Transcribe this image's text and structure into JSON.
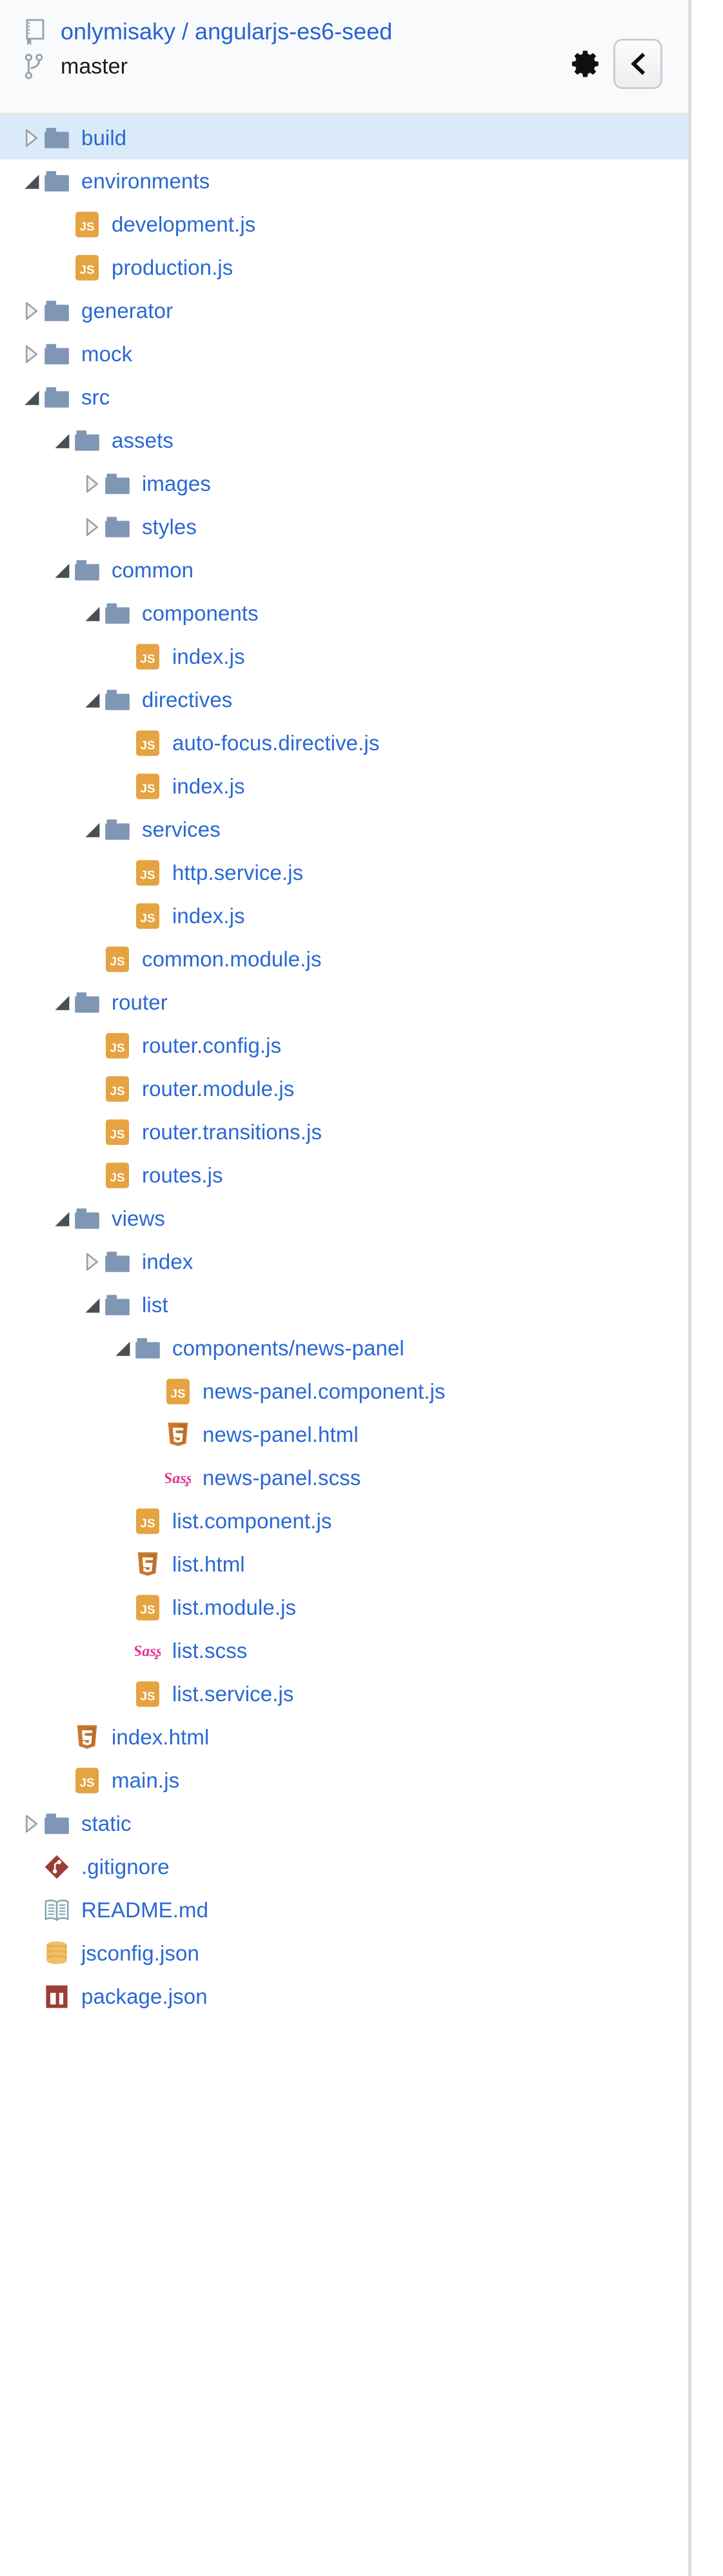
{
  "header": {
    "repo_icon": "repo-book-icon",
    "owner": "onlymisaky",
    "separator": "/",
    "repo_name": "angularjs-es6-seed",
    "repo_full": "onlymisaky / angularjs-es6-seed",
    "branch_icon": "git-branch-icon",
    "branch": "master",
    "settings_icon": "gear-icon",
    "collapse_icon": "chevron-left-icon",
    "settings_label": "Settings",
    "collapse_label": "Collapse panel",
    "colors": {
      "link": "#2962d0",
      "header_bg": "#f9fafb",
      "selected_row_bg": "#daeaf8"
    }
  },
  "tree": {
    "items": [
      {
        "label": "build",
        "depth": 0,
        "type": "folder",
        "icon": "folder-icon",
        "state": "collapsed",
        "selected": true
      },
      {
        "label": "environments",
        "depth": 0,
        "type": "folder",
        "icon": "folder-icon",
        "state": "expanded",
        "selected": false
      },
      {
        "label": "development.js",
        "depth": 1,
        "type": "file",
        "icon": "js-file-icon",
        "state": "leaf",
        "selected": false
      },
      {
        "label": "production.js",
        "depth": 1,
        "type": "file",
        "icon": "js-file-icon",
        "state": "leaf",
        "selected": false
      },
      {
        "label": "generator",
        "depth": 0,
        "type": "folder",
        "icon": "folder-icon",
        "state": "collapsed",
        "selected": false
      },
      {
        "label": "mock",
        "depth": 0,
        "type": "folder",
        "icon": "folder-icon",
        "state": "collapsed",
        "selected": false
      },
      {
        "label": "src",
        "depth": 0,
        "type": "folder",
        "icon": "folder-icon",
        "state": "expanded",
        "selected": false
      },
      {
        "label": "assets",
        "depth": 1,
        "type": "folder",
        "icon": "folder-icon",
        "state": "expanded",
        "selected": false
      },
      {
        "label": "images",
        "depth": 2,
        "type": "folder",
        "icon": "folder-icon",
        "state": "collapsed",
        "selected": false
      },
      {
        "label": "styles",
        "depth": 2,
        "type": "folder",
        "icon": "folder-icon",
        "state": "collapsed",
        "selected": false
      },
      {
        "label": "common",
        "depth": 1,
        "type": "folder",
        "icon": "folder-icon",
        "state": "expanded",
        "selected": false
      },
      {
        "label": "components",
        "depth": 2,
        "type": "folder",
        "icon": "folder-icon",
        "state": "expanded",
        "selected": false
      },
      {
        "label": "index.js",
        "depth": 3,
        "type": "file",
        "icon": "js-file-icon",
        "state": "leaf",
        "selected": false
      },
      {
        "label": "directives",
        "depth": 2,
        "type": "folder",
        "icon": "folder-icon",
        "state": "expanded",
        "selected": false
      },
      {
        "label": "auto-focus.directive.js",
        "depth": 3,
        "type": "file",
        "icon": "js-file-icon",
        "state": "leaf",
        "selected": false
      },
      {
        "label": "index.js",
        "depth": 3,
        "type": "file",
        "icon": "js-file-icon",
        "state": "leaf",
        "selected": false
      },
      {
        "label": "services",
        "depth": 2,
        "type": "folder",
        "icon": "folder-icon",
        "state": "expanded",
        "selected": false
      },
      {
        "label": "http.service.js",
        "depth": 3,
        "type": "file",
        "icon": "js-file-icon",
        "state": "leaf",
        "selected": false
      },
      {
        "label": "index.js",
        "depth": 3,
        "type": "file",
        "icon": "js-file-icon",
        "state": "leaf",
        "selected": false
      },
      {
        "label": "common.module.js",
        "depth": 2,
        "type": "file",
        "icon": "js-file-icon",
        "state": "leaf",
        "selected": false
      },
      {
        "label": "router",
        "depth": 1,
        "type": "folder",
        "icon": "folder-icon",
        "state": "expanded",
        "selected": false
      },
      {
        "label": "router.config.js",
        "depth": 2,
        "type": "file",
        "icon": "js-file-icon",
        "state": "leaf",
        "selected": false
      },
      {
        "label": "router.module.js",
        "depth": 2,
        "type": "file",
        "icon": "js-file-icon",
        "state": "leaf",
        "selected": false
      },
      {
        "label": "router.transitions.js",
        "depth": 2,
        "type": "file",
        "icon": "js-file-icon",
        "state": "leaf",
        "selected": false
      },
      {
        "label": "routes.js",
        "depth": 2,
        "type": "file",
        "icon": "js-file-icon",
        "state": "leaf",
        "selected": false
      },
      {
        "label": "views",
        "depth": 1,
        "type": "folder",
        "icon": "folder-icon",
        "state": "expanded",
        "selected": false
      },
      {
        "label": "index",
        "depth": 2,
        "type": "folder",
        "icon": "folder-icon",
        "state": "collapsed",
        "selected": false
      },
      {
        "label": "list",
        "depth": 2,
        "type": "folder",
        "icon": "folder-icon",
        "state": "expanded",
        "selected": false
      },
      {
        "label": "components/news-panel",
        "depth": 3,
        "type": "folder",
        "icon": "folder-icon",
        "state": "expanded",
        "selected": false
      },
      {
        "label": "news-panel.component.js",
        "depth": 4,
        "type": "file",
        "icon": "js-file-icon",
        "state": "leaf",
        "selected": false
      },
      {
        "label": "news-panel.html",
        "depth": 4,
        "type": "file",
        "icon": "html5-file-icon",
        "state": "leaf",
        "selected": false
      },
      {
        "label": "news-panel.scss",
        "depth": 4,
        "type": "file",
        "icon": "sass-file-icon",
        "state": "leaf",
        "selected": false
      },
      {
        "label": "list.component.js",
        "depth": 3,
        "type": "file",
        "icon": "js-file-icon",
        "state": "leaf",
        "selected": false
      },
      {
        "label": "list.html",
        "depth": 3,
        "type": "file",
        "icon": "html5-file-icon",
        "state": "leaf",
        "selected": false
      },
      {
        "label": "list.module.js",
        "depth": 3,
        "type": "file",
        "icon": "js-file-icon",
        "state": "leaf",
        "selected": false
      },
      {
        "label": "list.scss",
        "depth": 3,
        "type": "file",
        "icon": "sass-file-icon",
        "state": "leaf",
        "selected": false
      },
      {
        "label": "list.service.js",
        "depth": 3,
        "type": "file",
        "icon": "js-file-icon",
        "state": "leaf",
        "selected": false
      },
      {
        "label": "index.html",
        "depth": 1,
        "type": "file",
        "icon": "html5-file-icon",
        "state": "leaf",
        "selected": false
      },
      {
        "label": "main.js",
        "depth": 1,
        "type": "file",
        "icon": "js-file-icon",
        "state": "leaf",
        "selected": false
      },
      {
        "label": "static",
        "depth": 0,
        "type": "folder",
        "icon": "folder-icon",
        "state": "collapsed",
        "selected": false
      },
      {
        "label": ".gitignore",
        "depth": 0,
        "type": "file",
        "icon": "git-file-icon",
        "state": "leaf",
        "selected": false
      },
      {
        "label": "README.md",
        "depth": 0,
        "type": "file",
        "icon": "readme-file-icon",
        "state": "leaf",
        "selected": false
      },
      {
        "label": "jsconfig.json",
        "depth": 0,
        "type": "file",
        "icon": "config-db-icon",
        "state": "leaf",
        "selected": false
      },
      {
        "label": "package.json",
        "depth": 0,
        "type": "file",
        "icon": "npm-file-icon",
        "state": "leaf",
        "selected": false
      }
    ]
  }
}
